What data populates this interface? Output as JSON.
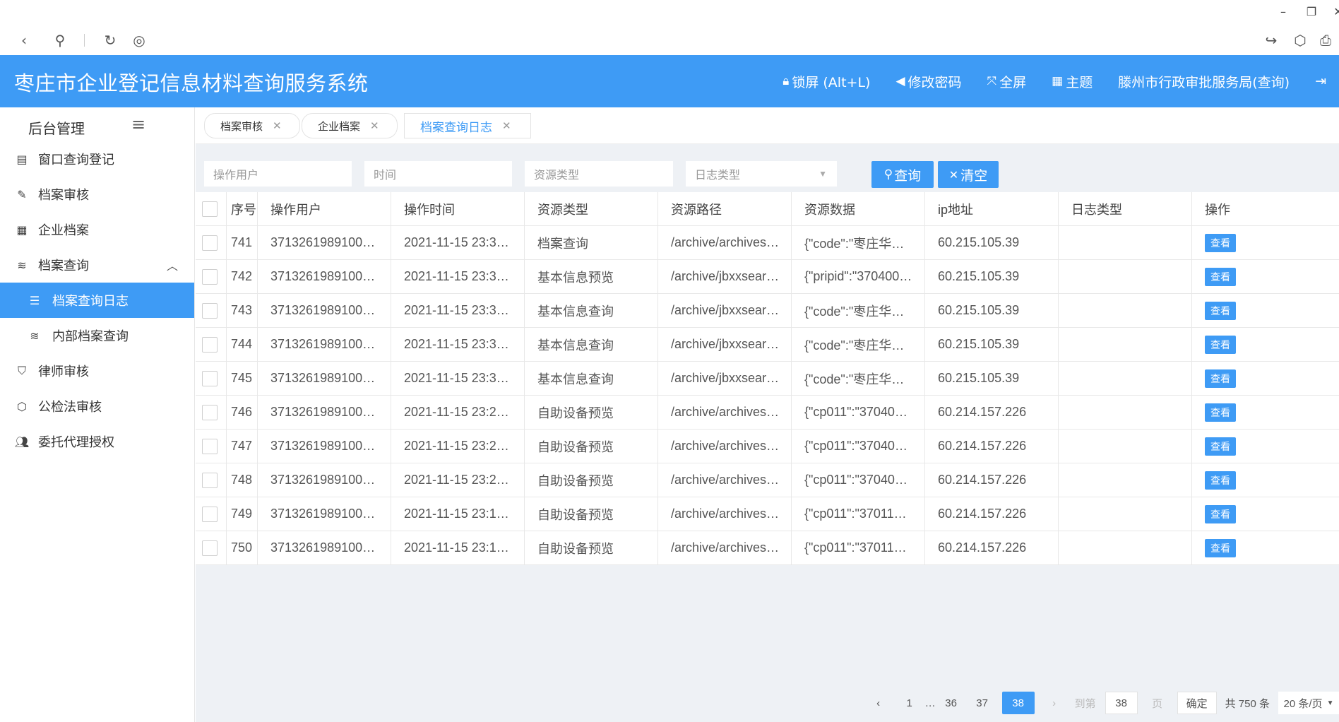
{
  "header": {
    "title": "枣庄市企业登记信息材料查询服务系统",
    "lock": "锁屏 (Alt+L)",
    "change_password": "修改密码",
    "fullscreen": "全屏",
    "theme": "主题",
    "user": "滕州市行政审批服务局(查询)"
  },
  "sidebar": {
    "title": "后台管理",
    "items": [
      {
        "label": "窗口查询登记",
        "icon": "register-icon"
      },
      {
        "label": "档案审核",
        "icon": "pencil-icon"
      },
      {
        "label": "企业档案",
        "icon": "calendar-icon"
      },
      {
        "label": "档案查询",
        "icon": "layers-icon"
      },
      {
        "label": "档案查询日志",
        "icon": "list-icon"
      },
      {
        "label": "内部档案查询",
        "icon": "layers-icon"
      },
      {
        "label": "律师审核",
        "icon": "shield-check-icon"
      },
      {
        "label": "公检法审核",
        "icon": "cube-icon"
      },
      {
        "label": "委托代理授权",
        "icon": "users-icon"
      }
    ]
  },
  "tabs": [
    {
      "label": "档案审核"
    },
    {
      "label": "企业档案"
    },
    {
      "label": "档案查询日志"
    }
  ],
  "filters": {
    "user_placeholder": "操作用户",
    "time_placeholder": "时间",
    "resource_type_placeholder": "资源类型",
    "log_type_placeholder": "日志类型",
    "query_label": "查询",
    "clear_label": "清空"
  },
  "table": {
    "columns": [
      "序号",
      "操作用户",
      "操作时间",
      "资源类型",
      "资源路径",
      "资源数据",
      "ip地址",
      "日志类型",
      "操作"
    ],
    "view_label": "查看",
    "rows": [
      {
        "seq": "741",
        "user": "3713261989100…",
        "time": "2021-11-15 23:3…",
        "rtype": "档案查询",
        "path": "/archive/archives…",
        "data": "{\"code\":\"枣庄华…",
        "ip": "60.215.105.39",
        "log": ""
      },
      {
        "seq": "742",
        "user": "3713261989100…",
        "time": "2021-11-15 23:3…",
        "rtype": "基本信息预览",
        "path": "/archive/jbxxsear…",
        "data": "{\"pripid\":\"370400…",
        "ip": "60.215.105.39",
        "log": ""
      },
      {
        "seq": "743",
        "user": "3713261989100…",
        "time": "2021-11-15 23:3…",
        "rtype": "基本信息查询",
        "path": "/archive/jbxxsear…",
        "data": "{\"code\":\"枣庄华…",
        "ip": "60.215.105.39",
        "log": ""
      },
      {
        "seq": "744",
        "user": "3713261989100…",
        "time": "2021-11-15 23:3…",
        "rtype": "基本信息查询",
        "path": "/archive/jbxxsear…",
        "data": "{\"code\":\"枣庄华…",
        "ip": "60.215.105.39",
        "log": ""
      },
      {
        "seq": "745",
        "user": "3713261989100…",
        "time": "2021-11-15 23:3…",
        "rtype": "基本信息查询",
        "path": "/archive/jbxxsear…",
        "data": "{\"code\":\"枣庄华…",
        "ip": "60.215.105.39",
        "log": ""
      },
      {
        "seq": "746",
        "user": "3713261989100…",
        "time": "2021-11-15 23:2…",
        "rtype": "自助设备预览",
        "path": "/archive/archives…",
        "data": "{\"cp011\":\"37040…",
        "ip": "60.214.157.226",
        "log": ""
      },
      {
        "seq": "747",
        "user": "3713261989100…",
        "time": "2021-11-15 23:2…",
        "rtype": "自助设备预览",
        "path": "/archive/archives…",
        "data": "{\"cp011\":\"37040…",
        "ip": "60.214.157.226",
        "log": ""
      },
      {
        "seq": "748",
        "user": "3713261989100…",
        "time": "2021-11-15 23:2…",
        "rtype": "自助设备预览",
        "path": "/archive/archives…",
        "data": "{\"cp011\":\"37040…",
        "ip": "60.214.157.226",
        "log": ""
      },
      {
        "seq": "749",
        "user": "3713261989100…",
        "time": "2021-11-15 23:1…",
        "rtype": "自助设备预览",
        "path": "/archive/archives…",
        "data": "{\"cp011\":\"37011…",
        "ip": "60.214.157.226",
        "log": ""
      },
      {
        "seq": "750",
        "user": "3713261989100…",
        "time": "2021-11-15 23:1…",
        "rtype": "自助设备预览",
        "path": "/archive/archives…",
        "data": "{\"cp011\":\"37011…",
        "ip": "60.214.157.226",
        "log": ""
      }
    ]
  },
  "pagination": {
    "first": "1",
    "ellipsis": "…",
    "p36": "36",
    "p37": "37",
    "current": "38",
    "goto_label": "到第",
    "goto_value": "38",
    "page_suffix": "页",
    "confirm": "确定",
    "total": "共 750 条",
    "page_size": "20 条/页"
  },
  "colors": {
    "primary": "#3e9bf5"
  }
}
